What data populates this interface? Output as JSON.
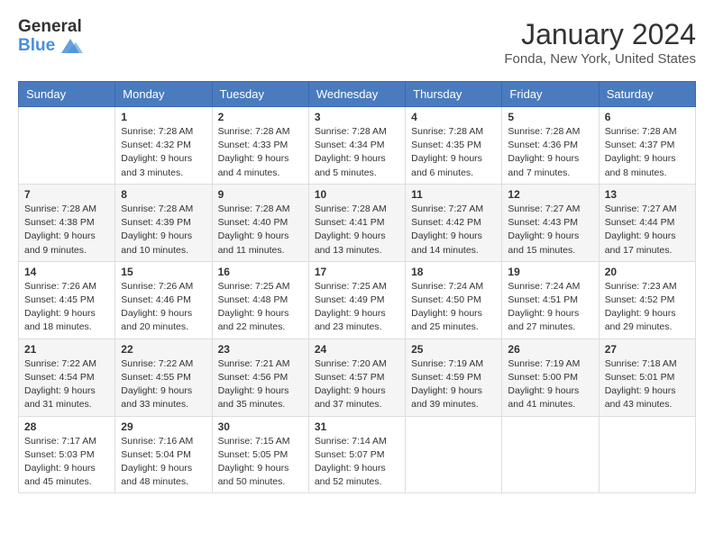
{
  "header": {
    "logo_general": "General",
    "logo_blue": "Blue",
    "month_year": "January 2024",
    "location": "Fonda, New York, United States"
  },
  "days_of_week": [
    "Sunday",
    "Monday",
    "Tuesday",
    "Wednesday",
    "Thursday",
    "Friday",
    "Saturday"
  ],
  "weeks": [
    [
      {
        "day": "",
        "info": ""
      },
      {
        "day": "1",
        "info": "Sunrise: 7:28 AM\nSunset: 4:32 PM\nDaylight: 9 hours\nand 3 minutes."
      },
      {
        "day": "2",
        "info": "Sunrise: 7:28 AM\nSunset: 4:33 PM\nDaylight: 9 hours\nand 4 minutes."
      },
      {
        "day": "3",
        "info": "Sunrise: 7:28 AM\nSunset: 4:34 PM\nDaylight: 9 hours\nand 5 minutes."
      },
      {
        "day": "4",
        "info": "Sunrise: 7:28 AM\nSunset: 4:35 PM\nDaylight: 9 hours\nand 6 minutes."
      },
      {
        "day": "5",
        "info": "Sunrise: 7:28 AM\nSunset: 4:36 PM\nDaylight: 9 hours\nand 7 minutes."
      },
      {
        "day": "6",
        "info": "Sunrise: 7:28 AM\nSunset: 4:37 PM\nDaylight: 9 hours\nand 8 minutes."
      }
    ],
    [
      {
        "day": "7",
        "info": "Sunrise: 7:28 AM\nSunset: 4:38 PM\nDaylight: 9 hours\nand 9 minutes."
      },
      {
        "day": "8",
        "info": "Sunrise: 7:28 AM\nSunset: 4:39 PM\nDaylight: 9 hours\nand 10 minutes."
      },
      {
        "day": "9",
        "info": "Sunrise: 7:28 AM\nSunset: 4:40 PM\nDaylight: 9 hours\nand 11 minutes."
      },
      {
        "day": "10",
        "info": "Sunrise: 7:28 AM\nSunset: 4:41 PM\nDaylight: 9 hours\nand 13 minutes."
      },
      {
        "day": "11",
        "info": "Sunrise: 7:27 AM\nSunset: 4:42 PM\nDaylight: 9 hours\nand 14 minutes."
      },
      {
        "day": "12",
        "info": "Sunrise: 7:27 AM\nSunset: 4:43 PM\nDaylight: 9 hours\nand 15 minutes."
      },
      {
        "day": "13",
        "info": "Sunrise: 7:27 AM\nSunset: 4:44 PM\nDaylight: 9 hours\nand 17 minutes."
      }
    ],
    [
      {
        "day": "14",
        "info": "Sunrise: 7:26 AM\nSunset: 4:45 PM\nDaylight: 9 hours\nand 18 minutes."
      },
      {
        "day": "15",
        "info": "Sunrise: 7:26 AM\nSunset: 4:46 PM\nDaylight: 9 hours\nand 20 minutes."
      },
      {
        "day": "16",
        "info": "Sunrise: 7:25 AM\nSunset: 4:48 PM\nDaylight: 9 hours\nand 22 minutes."
      },
      {
        "day": "17",
        "info": "Sunrise: 7:25 AM\nSunset: 4:49 PM\nDaylight: 9 hours\nand 23 minutes."
      },
      {
        "day": "18",
        "info": "Sunrise: 7:24 AM\nSunset: 4:50 PM\nDaylight: 9 hours\nand 25 minutes."
      },
      {
        "day": "19",
        "info": "Sunrise: 7:24 AM\nSunset: 4:51 PM\nDaylight: 9 hours\nand 27 minutes."
      },
      {
        "day": "20",
        "info": "Sunrise: 7:23 AM\nSunset: 4:52 PM\nDaylight: 9 hours\nand 29 minutes."
      }
    ],
    [
      {
        "day": "21",
        "info": "Sunrise: 7:22 AM\nSunset: 4:54 PM\nDaylight: 9 hours\nand 31 minutes."
      },
      {
        "day": "22",
        "info": "Sunrise: 7:22 AM\nSunset: 4:55 PM\nDaylight: 9 hours\nand 33 minutes."
      },
      {
        "day": "23",
        "info": "Sunrise: 7:21 AM\nSunset: 4:56 PM\nDaylight: 9 hours\nand 35 minutes."
      },
      {
        "day": "24",
        "info": "Sunrise: 7:20 AM\nSunset: 4:57 PM\nDaylight: 9 hours\nand 37 minutes."
      },
      {
        "day": "25",
        "info": "Sunrise: 7:19 AM\nSunset: 4:59 PM\nDaylight: 9 hours\nand 39 minutes."
      },
      {
        "day": "26",
        "info": "Sunrise: 7:19 AM\nSunset: 5:00 PM\nDaylight: 9 hours\nand 41 minutes."
      },
      {
        "day": "27",
        "info": "Sunrise: 7:18 AM\nSunset: 5:01 PM\nDaylight: 9 hours\nand 43 minutes."
      }
    ],
    [
      {
        "day": "28",
        "info": "Sunrise: 7:17 AM\nSunset: 5:03 PM\nDaylight: 9 hours\nand 45 minutes."
      },
      {
        "day": "29",
        "info": "Sunrise: 7:16 AM\nSunset: 5:04 PM\nDaylight: 9 hours\nand 48 minutes."
      },
      {
        "day": "30",
        "info": "Sunrise: 7:15 AM\nSunset: 5:05 PM\nDaylight: 9 hours\nand 50 minutes."
      },
      {
        "day": "31",
        "info": "Sunrise: 7:14 AM\nSunset: 5:07 PM\nDaylight: 9 hours\nand 52 minutes."
      },
      {
        "day": "",
        "info": ""
      },
      {
        "day": "",
        "info": ""
      },
      {
        "day": "",
        "info": ""
      }
    ]
  ]
}
